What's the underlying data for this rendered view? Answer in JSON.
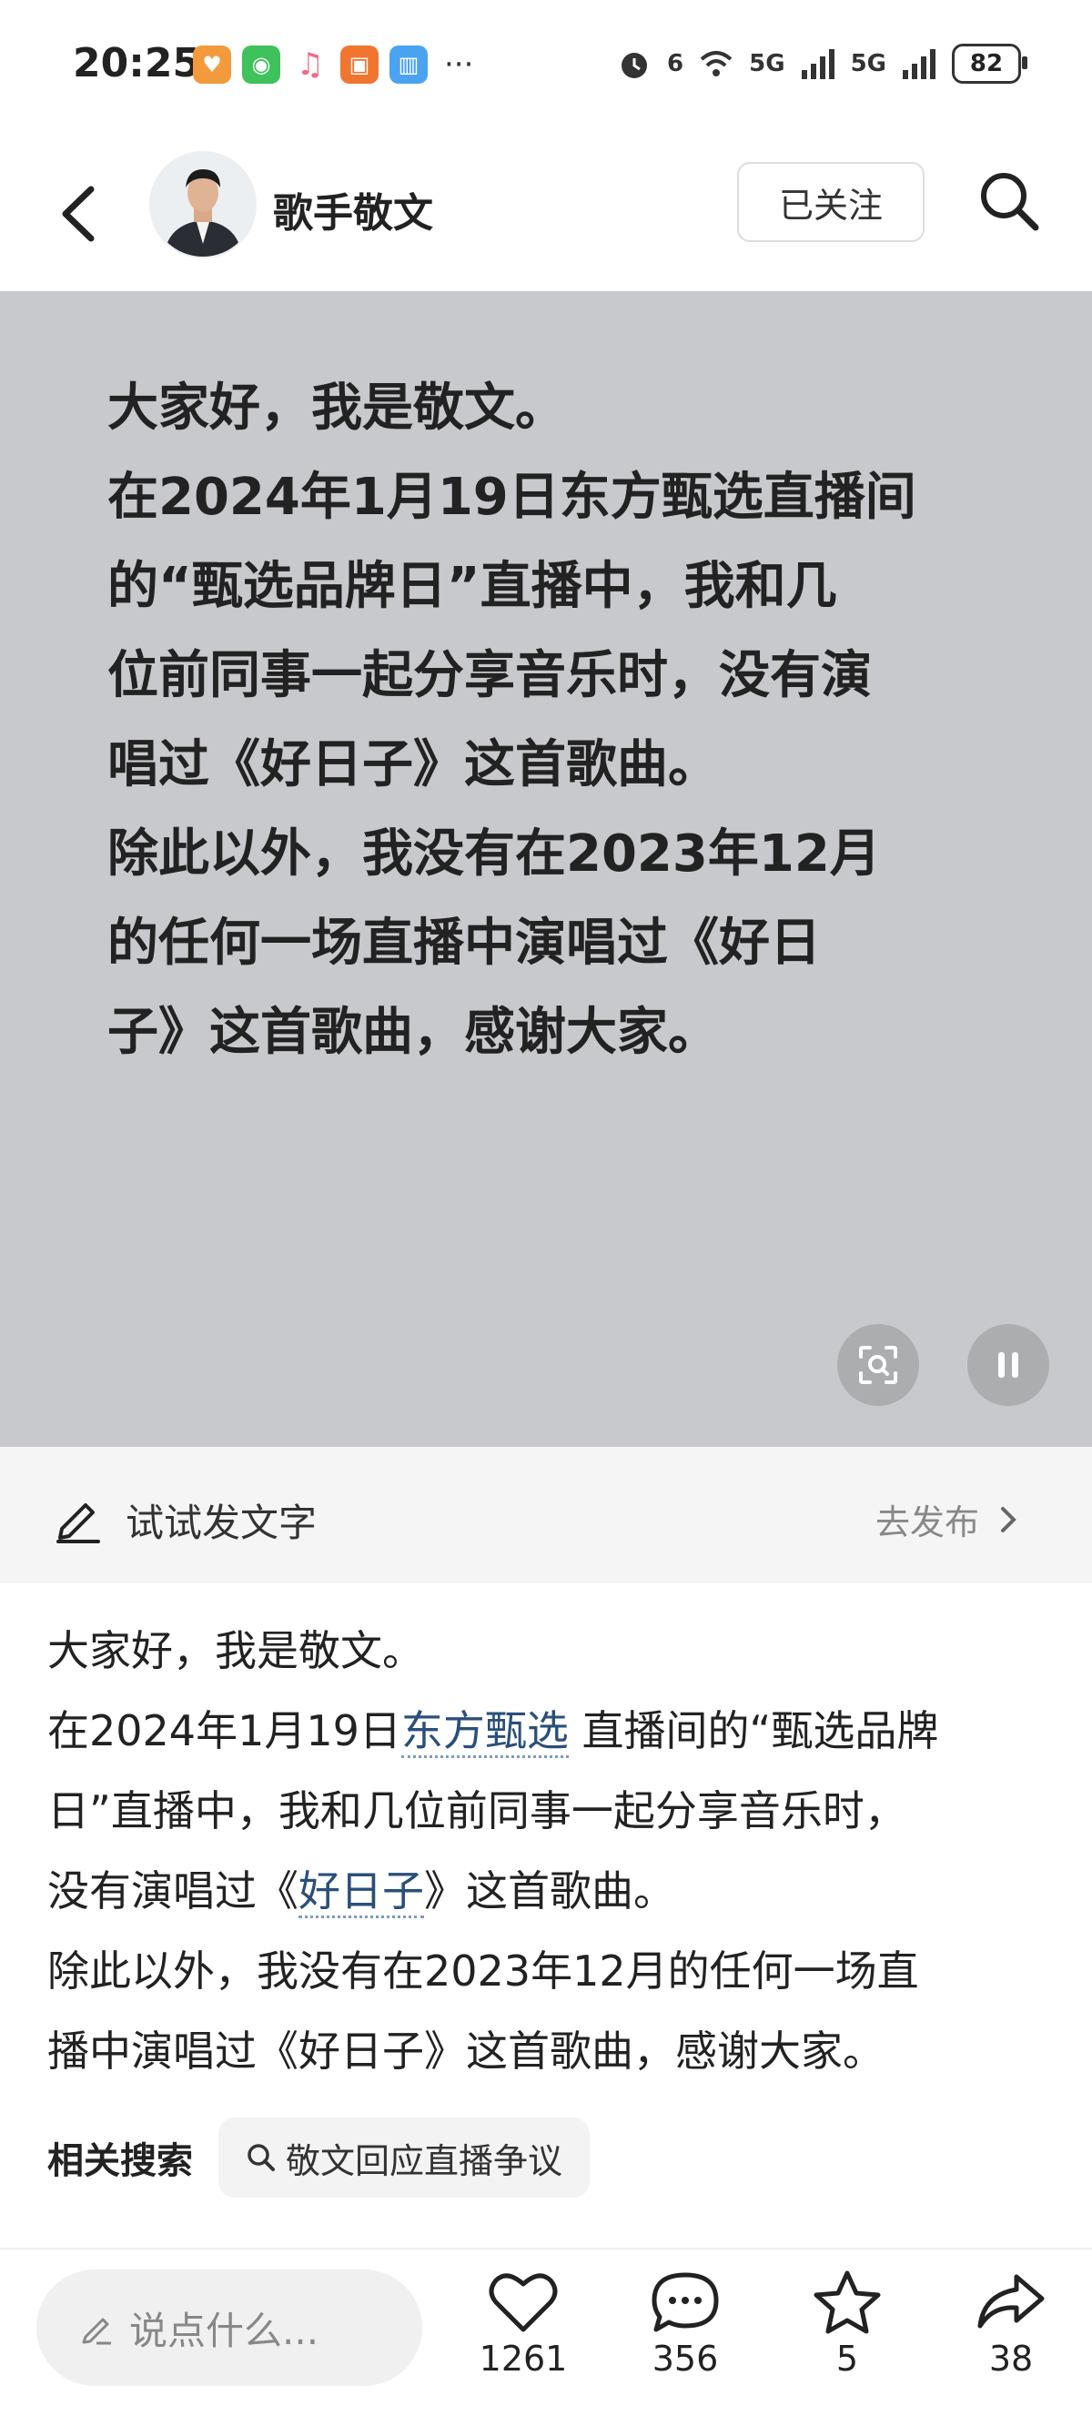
{
  "status_bar": {
    "time": "20:25",
    "signal1": "6",
    "net1": "5G",
    "net2": "5G",
    "battery": "82",
    "more": "···"
  },
  "header": {
    "title": "歌手敬文",
    "follow_label": "已关注"
  },
  "media": {
    "lines": [
      "大家好，我是敬文。",
      "在2024年1月19日东方甄选直播间",
      "的“甄选品牌日”直播中，我和几",
      "位前同事一起分享音乐时，没有演",
      "唱过《好日子》这首歌曲。",
      "除此以外，我没有在2023年12月",
      "的任何一场直播中演唱过《好日",
      "子》这首歌曲，感谢大家。"
    ]
  },
  "compose": {
    "label": "试试发文字",
    "publish_label": "去发布"
  },
  "article": {
    "line1": "大家好，我是敬文。",
    "line2_pre": "在2024年1月19日",
    "line2_link": "东方甄选",
    "line2_post": " 直播间的“甄选品牌",
    "line3": "日”直播中，我和几位前同事一起分享音乐时，",
    "line4_pre": "没有演唱过《",
    "line4_link": "好日子",
    "line4_post": "》这首歌曲。",
    "line5": "除此以外，我没有在2023年12月的任何一场直",
    "line6": "播中演唱过《好日子》这首歌曲，感谢大家。"
  },
  "related": {
    "label": "相关搜索",
    "chip": "敬文回应直播争议"
  },
  "bottom": {
    "comment_placeholder": "说点什么...",
    "likes": "1261",
    "comments": "356",
    "favorites": "5",
    "shares": "38"
  },
  "colors": {
    "media_bg": "#c8c9cd",
    "link": "#2b4f7a"
  }
}
